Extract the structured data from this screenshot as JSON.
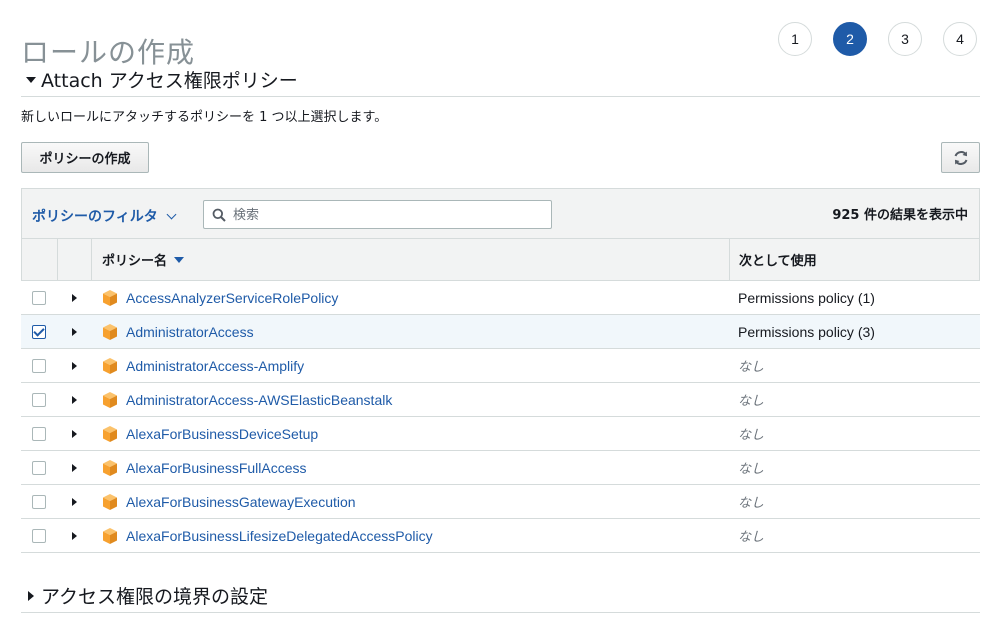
{
  "page": {
    "title": "ロールの作成",
    "steps": [
      "1",
      "2",
      "3",
      "4"
    ],
    "active_step": "2"
  },
  "attach_section": {
    "title": "Attach アクセス権限ポリシー",
    "description": "新しいロールにアタッチするポリシーを 1 つ以上選択します。",
    "create_button": "ポリシーの作成"
  },
  "filter": {
    "label": "ポリシーのフィルタ",
    "search_placeholder": "検索",
    "search_value": "",
    "result_count": "925 件の結果を表示中"
  },
  "table": {
    "columns": {
      "name": "ポリシー名",
      "used_as": "次として使用"
    },
    "rows": [
      {
        "name": "AccessAnalyzerServiceRolePolicy",
        "used_as": "Permissions policy (1)",
        "checked": false
      },
      {
        "name": "AdministratorAccess",
        "used_as": "Permissions policy (3)",
        "checked": true
      },
      {
        "name": "AdministratorAccess-Amplify",
        "used_as": "なし",
        "checked": false
      },
      {
        "name": "AdministratorAccess-AWSElasticBeanstalk",
        "used_as": "なし",
        "checked": false
      },
      {
        "name": "AlexaForBusinessDeviceSetup",
        "used_as": "なし",
        "checked": false
      },
      {
        "name": "AlexaForBusinessFullAccess",
        "used_as": "なし",
        "checked": false
      },
      {
        "name": "AlexaForBusinessGatewayExecution",
        "used_as": "なし",
        "checked": false
      },
      {
        "name": "AlexaForBusinessLifesizeDelegatedAccessPolicy",
        "used_as": "なし",
        "checked": false
      }
    ]
  },
  "boundary_section": {
    "title": "アクセス権限の境界の設定"
  },
  "icons": {
    "policy": "aws-policy-cube-icon",
    "refresh": "refresh-icon",
    "search": "search-icon"
  },
  "colors": {
    "accent": "#1f5ba8",
    "policy_icon": "#f7a12f",
    "selected_row": "#f1f7fb"
  }
}
